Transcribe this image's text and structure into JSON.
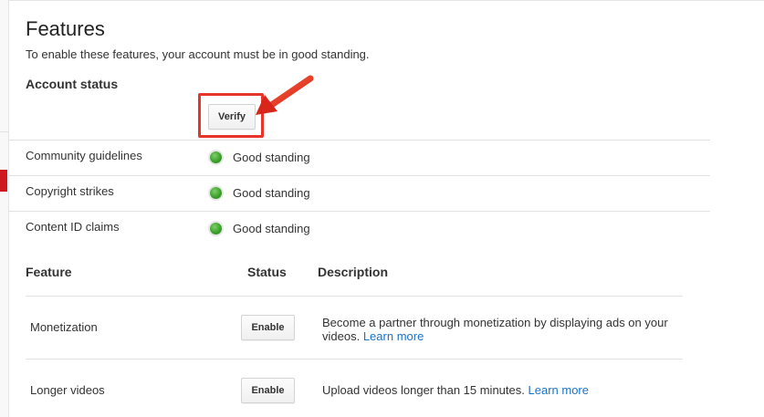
{
  "header": {
    "title": "Features",
    "subtitle": "To enable these features, your account must be in good standing."
  },
  "account_status": {
    "heading": "Account status",
    "verify_label": "Verify",
    "items": [
      {
        "label": "Community guidelines",
        "status": "Good standing"
      },
      {
        "label": "Copyright strikes",
        "status": "Good standing"
      },
      {
        "label": "Content ID claims",
        "status": "Good standing"
      }
    ],
    "status_color": "#3da02c"
  },
  "features_table": {
    "columns": {
      "feature": "Feature",
      "status": "Status",
      "description": "Description"
    },
    "rows": [
      {
        "feature": "Monetization",
        "button": "Enable",
        "description": "Become a partner through monetization by displaying ads on your videos.",
        "link": "Learn more"
      },
      {
        "feature": "Longer videos",
        "button": "Enable",
        "description": "Upload videos longer than 15 minutes.",
        "link": "Learn more"
      }
    ]
  },
  "colors": {
    "highlight": "#e8352a",
    "link": "#1a73c9",
    "left_rail_marker": "#cc181e"
  }
}
